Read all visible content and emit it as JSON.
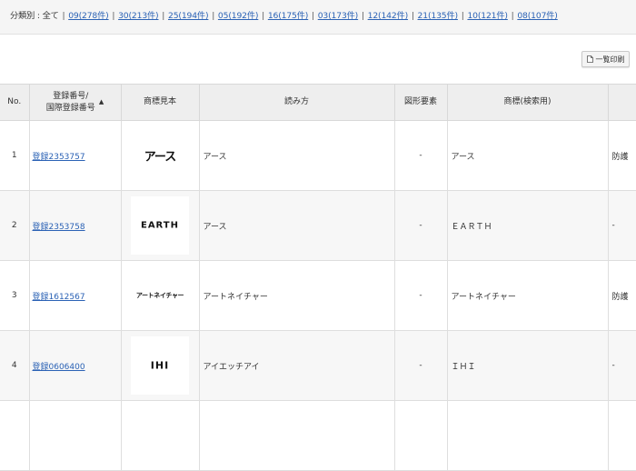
{
  "filter": {
    "label": "分類別 : ",
    "all": "全て",
    "links": [
      "09(278件)",
      "30(213件)",
      "25(194件)",
      "05(192件)",
      "16(175件)",
      "03(173件)",
      "12(142件)",
      "21(135件)",
      "10(121件)",
      "08(107件)"
    ]
  },
  "toolbar": {
    "print_label": "一覧印刷"
  },
  "table": {
    "headers": {
      "no": "No.",
      "reg_line1": "登録番号/",
      "reg_line2": "国際登録番号",
      "image": "商標見本",
      "reading": "読み方",
      "figure": "図形要素",
      "search": "商標(検索用)",
      "last": ""
    },
    "rows": [
      {
        "no": "1",
        "reg": "登録2353757",
        "mark": "アース",
        "reading": "アース",
        "figure": "-",
        "search": "アース",
        "last": "防護"
      },
      {
        "no": "2",
        "reg": "登録2353758",
        "mark": "EARTH",
        "reading": "アース",
        "figure": "-",
        "search": "ＥＡＲＴＨ",
        "last": "-"
      },
      {
        "no": "3",
        "reg": "登録1612567",
        "mark": "アートネイチャー",
        "reading": "アートネイチャー",
        "figure": "-",
        "search": "アートネイチャー",
        "last": "防護"
      },
      {
        "no": "4",
        "reg": "登録0606400",
        "mark": "IHI",
        "reading": "アイエッチアイ",
        "figure": "-",
        "search": "ＩＨＩ",
        "last": "-"
      },
      {
        "no": "",
        "reg": "",
        "mark": "",
        "reading": "",
        "figure": "",
        "search": "",
        "last": ""
      }
    ]
  },
  "colors": {
    "link": "#2b62b5",
    "header_bg": "#eeeeee",
    "filter_bg": "#f5f5f5"
  }
}
